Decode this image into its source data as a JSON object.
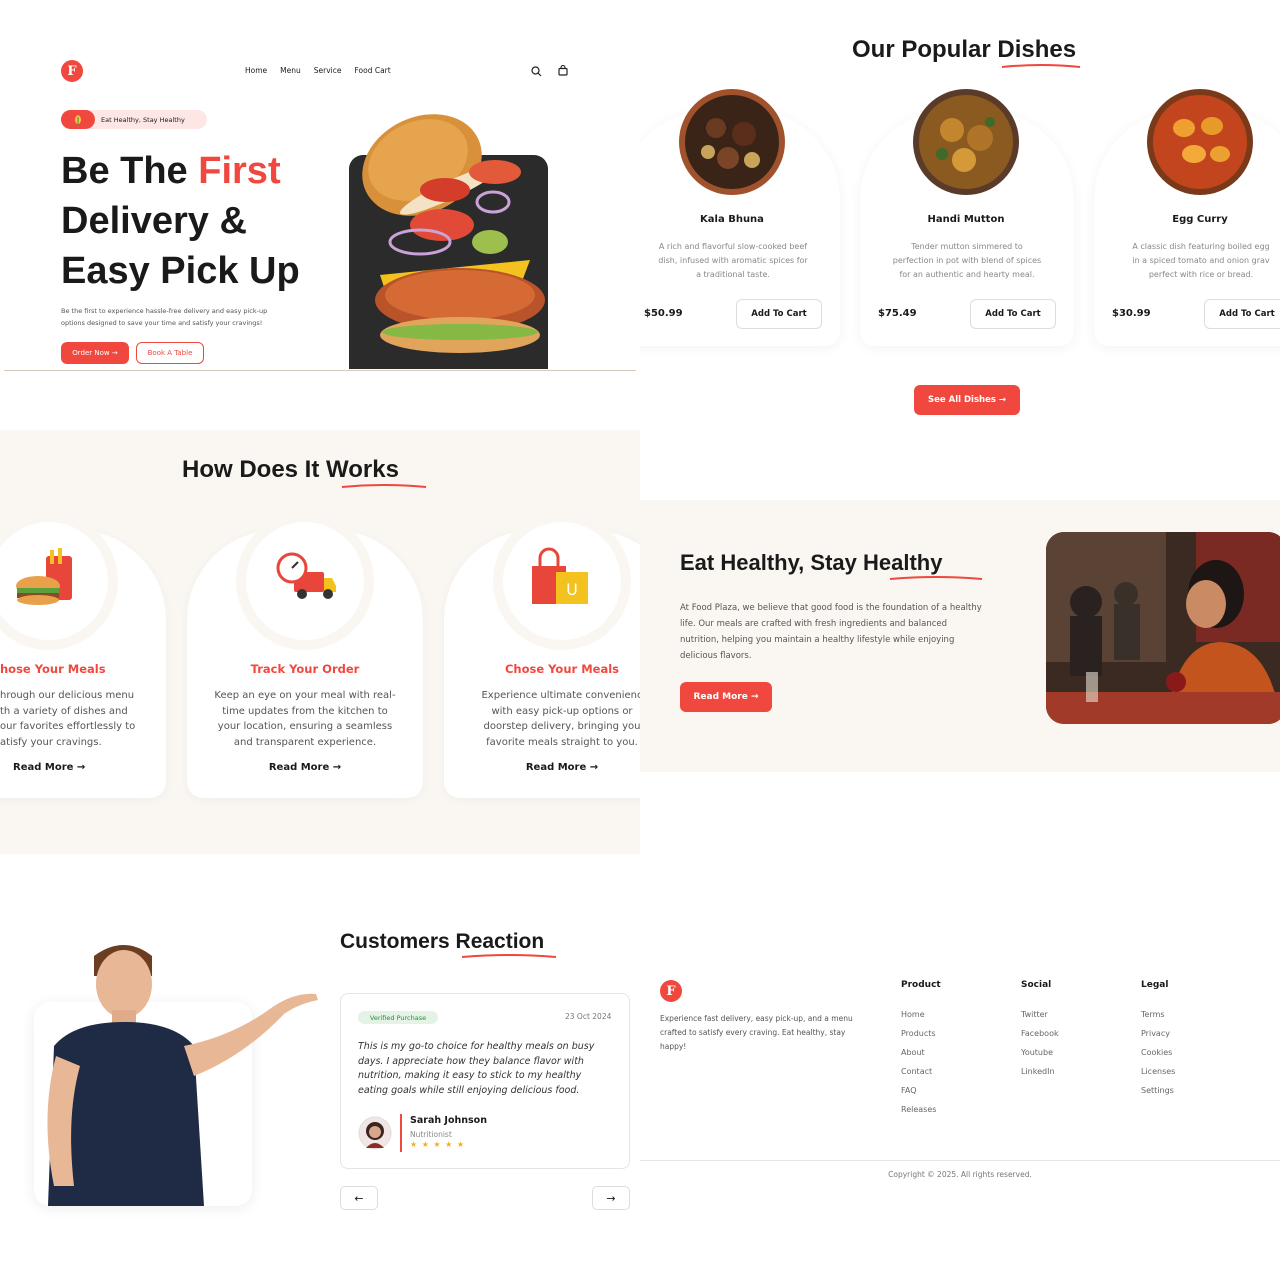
{
  "hero": {
    "nav": [
      "Home",
      "Menu",
      "Service",
      "Food Cart"
    ],
    "badge": "Eat Healthy, Stay Healthy",
    "title_a": "Be The ",
    "title_b": "First",
    "title_c": "Delivery &",
    "title_d": "Easy Pick Up",
    "desc_1": "Be the first to experience hassle-free delivery and easy pick-up",
    "desc_2": "options designed to save your time and satisfy your cravings!",
    "order_now": "Order Now →",
    "book_table": "Book A Table"
  },
  "popular": {
    "title_a": "Our Popular ",
    "title_b": "Dishes",
    "dishes": [
      {
        "name": "Kala Bhuna",
        "d1": "A rich and flavorful slow-cooked beef",
        "d2": "dish, infused with aromatic spices for",
        "d3": "a traditional taste.",
        "price": "$50.99",
        "cta": "Add To Cart"
      },
      {
        "name": "Handi Mutton",
        "d1": "Tender mutton simmered to",
        "d2": "perfection in pot with blend of spices",
        "d3": "for an authentic and hearty meal.",
        "price": "$75.49",
        "cta": "Add To Cart"
      },
      {
        "name": "Egg Curry",
        "d1": "A classic dish featuring boiled egg",
        "d2": "in a spiced tomato and onion grav",
        "d3": "perfect with rice or bread.",
        "price": "$30.99",
        "cta": "Add To Cart"
      }
    ],
    "see_all": "See All Dishes →"
  },
  "how": {
    "title_a": "How Does It ",
    "title_b": "Works",
    "steps": [
      {
        "title": "hose Your Meals",
        "l1": "hrough our delicious menu",
        "l2": "th a variety of dishes and",
        "l3": "our favorites effortlessly to",
        "l4": "atisfy your cravings.",
        "link": "Read More →"
      },
      {
        "title": "Track Your Order",
        "l1": "Keep an eye on your meal with real-",
        "l2": "time updates from the kitchen to",
        "l3": "your location, ensuring a seamless",
        "l4": "and transparent experience.",
        "link": "Read More →"
      },
      {
        "title": "Chose Your Meals",
        "l1": "Experience ultimate convenienc",
        "l2": "with easy pick-up options or",
        "l3": "doorstep delivery, bringing you",
        "l4": "favorite meals straight to you.",
        "link": "Read More →"
      }
    ]
  },
  "healthy": {
    "title_a": "Eat Healthy, Stay ",
    "title_b": "Healthy",
    "p1": "At Food Plaza, we believe that good food is the foundation of a healthy",
    "p2": "life. Our meals are crafted with fresh ingredients and balanced",
    "p3": "nutrition, helping you maintain a healthy lifestyle while enjoying",
    "p4": "delicious flavors.",
    "cta": "Read More →"
  },
  "reviews": {
    "title_a": "Customers ",
    "title_b": "Reaction",
    "tag": "Verified Purchase",
    "date": "23 Oct 2024",
    "q1": "This is my go-to choice for healthy meals on busy",
    "q2": "days. I appreciate how they balance flavor with",
    "q3": "nutrition, making it easy to stick to my healthy",
    "q4": "eating goals while still enjoying delicious food.",
    "name": "Sarah Johnson",
    "role": "Nutritionist",
    "stars": "★ ★ ★ ★ ★",
    "prev": "←",
    "next": "→"
  },
  "footer": {
    "about_1": "Experience fast delivery, easy pick-up, and a menu",
    "about_2": "crafted to satisfy every craving. Eat healthy, stay",
    "about_3": "happy!",
    "product_title": "Product",
    "product": [
      "Home",
      "Products",
      "About",
      "Contact",
      "FAQ",
      "Releases"
    ],
    "social_title": "Social",
    "social": [
      "Twitter",
      "Facebook",
      "Youtube",
      "LinkedIn"
    ],
    "legal_title": "Legal",
    "legal": [
      "Terms",
      "Privacy",
      "Cookies",
      "Licenses",
      "Settings"
    ],
    "copyright": "Copyright © 2025. All rights reserved."
  },
  "colors": {
    "accent": "#f0483e",
    "cream": "#faf7f2",
    "dark": "#1a1a1a"
  }
}
